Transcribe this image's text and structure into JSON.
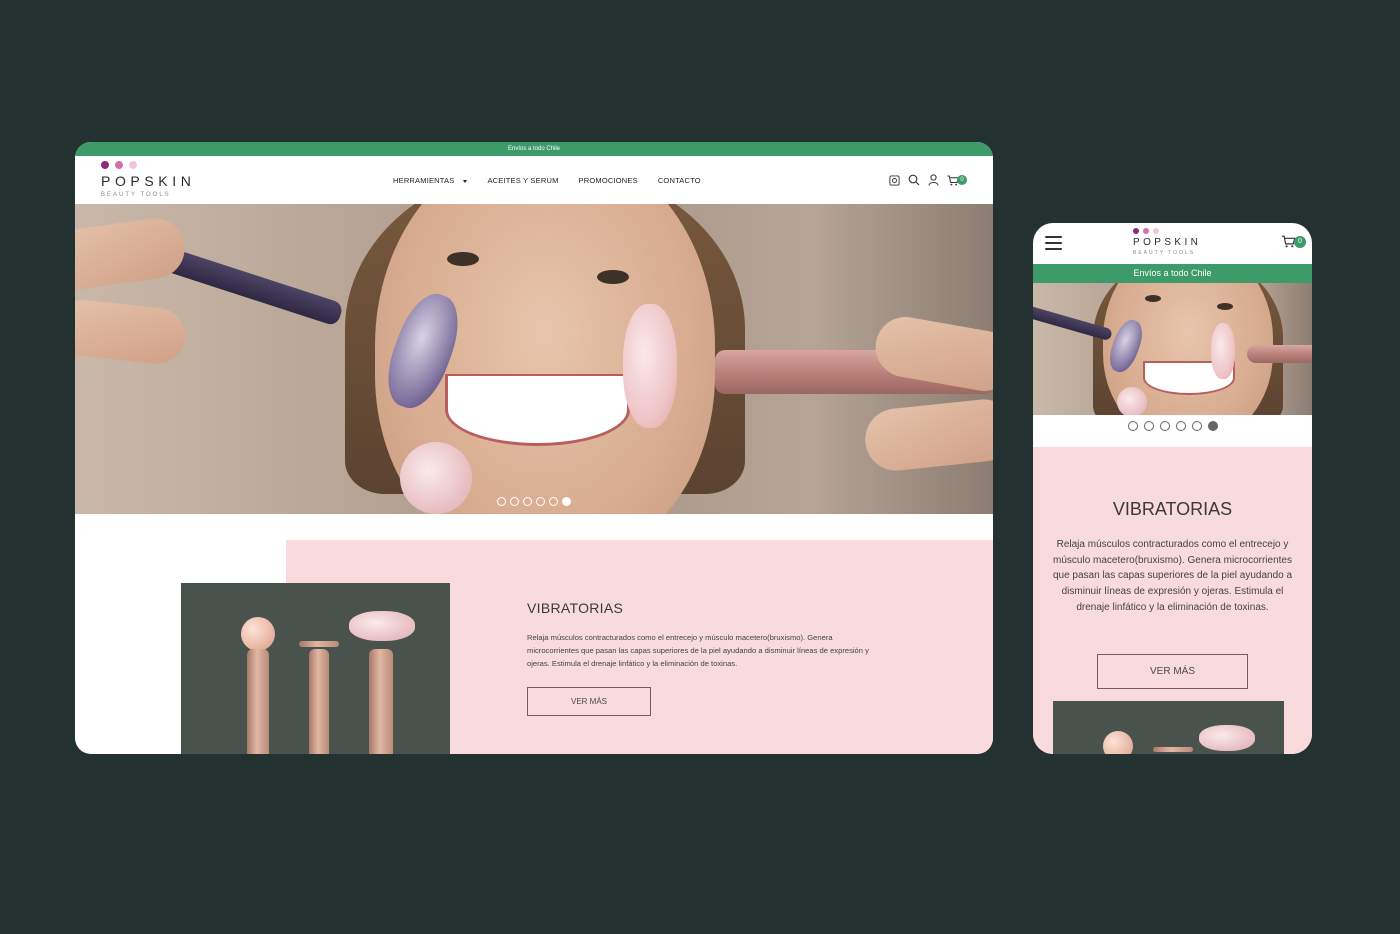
{
  "brand": {
    "name": "POPSKIN",
    "tagline": "BEAUTY TOOLS",
    "dot_colors": [
      "#8e2a7a",
      "#d36fae",
      "#f0c6df"
    ]
  },
  "colors": {
    "background": "#243131",
    "accent_green": "#3d9b6a",
    "feature_pink": "#f9dadd"
  },
  "desktop": {
    "announcement": "Envíos a todo Chile",
    "nav": [
      {
        "label": "HERRAMIENTAS",
        "has_dropdown": true
      },
      {
        "label": "ACEITES Y SERUM"
      },
      {
        "label": "PROMOCIONES"
      },
      {
        "label": "CONTACTO"
      }
    ],
    "icons": [
      "instagram-icon",
      "search-icon",
      "user-icon",
      "cart-icon"
    ],
    "cart_count": "0",
    "slider": {
      "total": 6,
      "active": 6
    },
    "feature": {
      "title": "VIBRATORIAS",
      "text": "Relaja músculos contracturados como el entrecejo y músculo macetero(bruxismo). Genera microcorrientes que pasan las capas superiores de la piel ayudando a disminuir líneas de expresión y ojeras. Estimula el drenaje linfático y la eliminación de toxinas.",
      "button": "VER MÁS"
    },
    "product_brand": "POPSKIN"
  },
  "mobile": {
    "announcement": "Envíos a todo Chile",
    "cart_count": "0",
    "slider": {
      "total": 6,
      "active": 6
    },
    "feature": {
      "title": "VIBRATORIAS",
      "text": "Relaja músculos contracturados como el entrecejo y músculo macetero(bruxismo). Genera microcorrientes que pasan las capas superiores de la piel ayudando a disminuir líneas de expresión y ojeras. Estimula el drenaje linfático y la eliminación de toxinas.",
      "button": "VER MÁS"
    }
  }
}
